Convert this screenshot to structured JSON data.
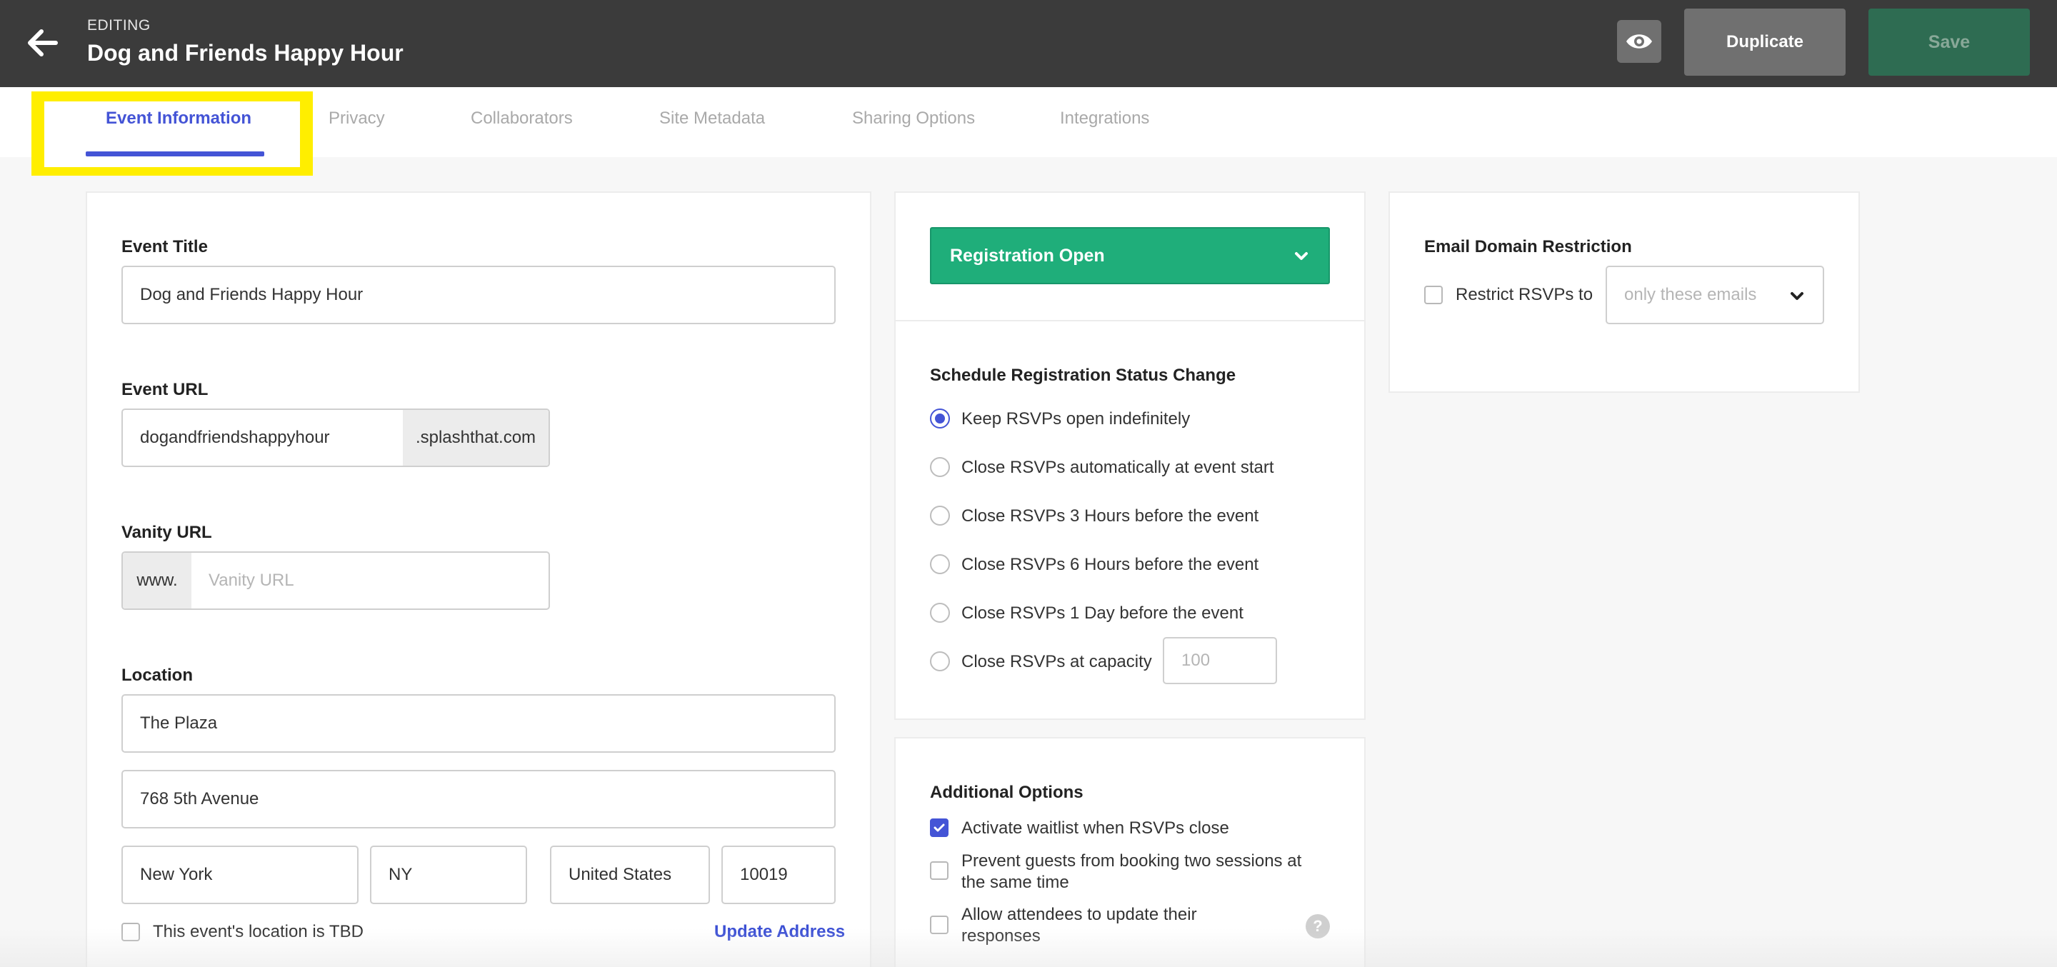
{
  "header": {
    "mode_label": "EDITING",
    "event_name": "Dog and Friends Happy Hour",
    "duplicate_label": "Duplicate",
    "save_label": "Save",
    "back_icon": "arrow-left-icon",
    "preview_icon": "eye-icon"
  },
  "tabs": [
    {
      "label": "Event Information",
      "active": true
    },
    {
      "label": "Privacy"
    },
    {
      "label": "Collaborators"
    },
    {
      "label": "Site Metadata"
    },
    {
      "label": "Sharing Options"
    },
    {
      "label": "Integrations"
    }
  ],
  "event_form": {
    "title_label": "Event Title",
    "title_value": "Dog and Friends Happy Hour",
    "url_label": "Event URL",
    "url_value": "dogandfriendshappyhour",
    "url_suffix": ".splashthat.com",
    "vanity_label": "Vanity URL",
    "vanity_prefix": "www.",
    "vanity_placeholder": "Vanity URL",
    "location_label": "Location",
    "venue": "The Plaza",
    "street": "768 5th Avenue",
    "city": "New York",
    "state": "NY",
    "country": "United States",
    "zip": "10019",
    "tbd_label": "This event's location is TBD",
    "update_address_label": "Update Address"
  },
  "registration": {
    "status": "Registration Open",
    "schedule_title": "Schedule Registration Status Change",
    "options": [
      {
        "label": "Keep RSVPs open indefinitely",
        "selected": true
      },
      {
        "label": "Close RSVPs automatically at event start"
      },
      {
        "label": "Close RSVPs 3 Hours before the event"
      },
      {
        "label": "Close RSVPs 6 Hours before the event"
      },
      {
        "label": "Close RSVPs 1 Day before the event"
      },
      {
        "label": "Close RSVPs at capacity"
      }
    ],
    "capacity_placeholder": "100"
  },
  "additional_options": {
    "title": "Additional Options",
    "items": [
      {
        "label": "Activate waitlist when RSVPs close",
        "checked": true
      },
      {
        "label_line1": "Prevent guests from booking two sessions at",
        "label_line2": "the same time",
        "checked": false
      },
      {
        "label_line1": "Allow attendees to update their",
        "label_line2": "responses",
        "checked": false
      }
    ],
    "help_icon_text": "?"
  },
  "email_restriction": {
    "title": "Email Domain Restriction",
    "checkbox_label": "Restrict RSVPs to",
    "select_value": "only these emails"
  },
  "colors": {
    "topbar": "#3b3b3b",
    "accent": "#4454d6",
    "registration_green": "#1fae7a",
    "save_green": "#2e6c52",
    "tab_highlight": "#ffee00"
  }
}
